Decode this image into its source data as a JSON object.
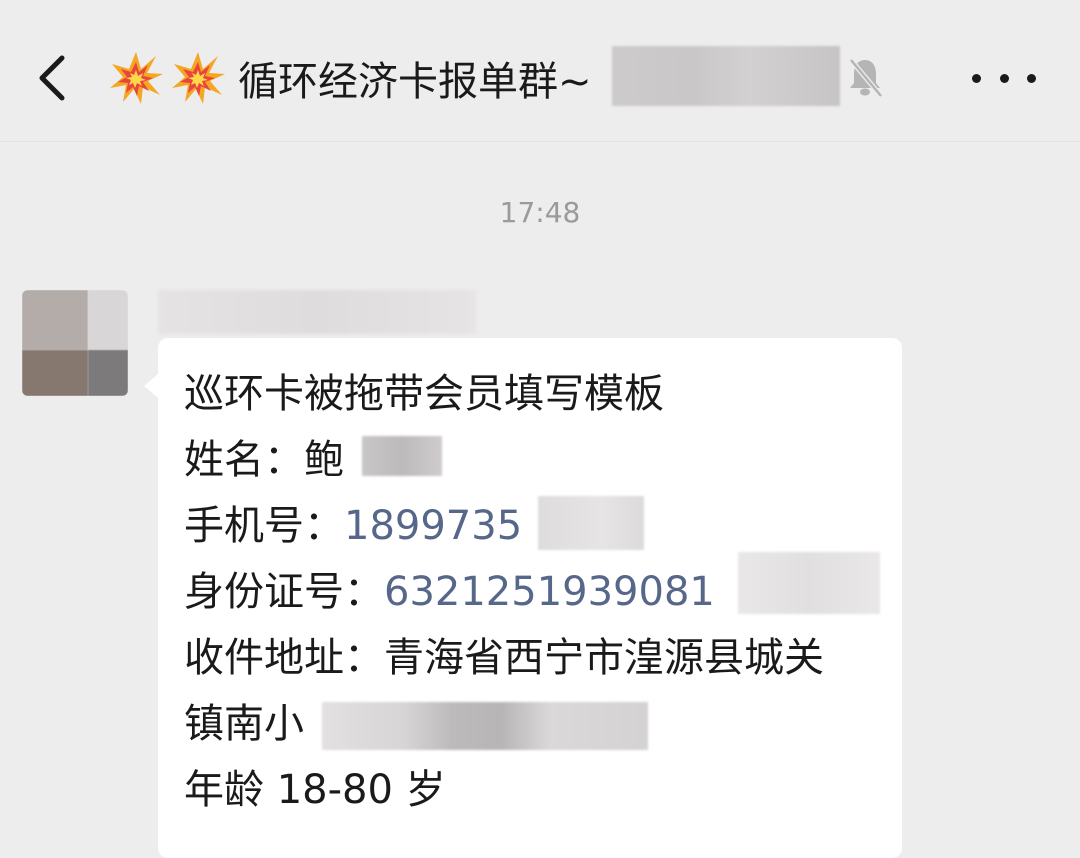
{
  "header": {
    "title": "循环经济卡报单群~",
    "icons": [
      "back-arrow-icon",
      "collision-emoji-icon",
      "collision-emoji-icon",
      "mute-bell-icon",
      "more-icon"
    ]
  },
  "chat": {
    "timestamp": "17:48",
    "message": {
      "line1": "巡环卡被拖带会员填写模板",
      "name_label": "姓名：",
      "name_value": "鲍",
      "phone_label": "手机号：",
      "phone_value": "1899735",
      "id_label": "身份证号：",
      "id_value": "6321251939081",
      "address_label": "收件地址：",
      "address_value": "青海省西宁市湟源县城关",
      "address_line2": "镇南小",
      "age_label": "年龄 ",
      "age_value": "18-80",
      "age_unit": " 岁"
    }
  },
  "colors": {
    "background": "#ededed",
    "bubble": "#ffffff",
    "number_link": "#56678a",
    "timestamp": "#9a9a9a"
  }
}
